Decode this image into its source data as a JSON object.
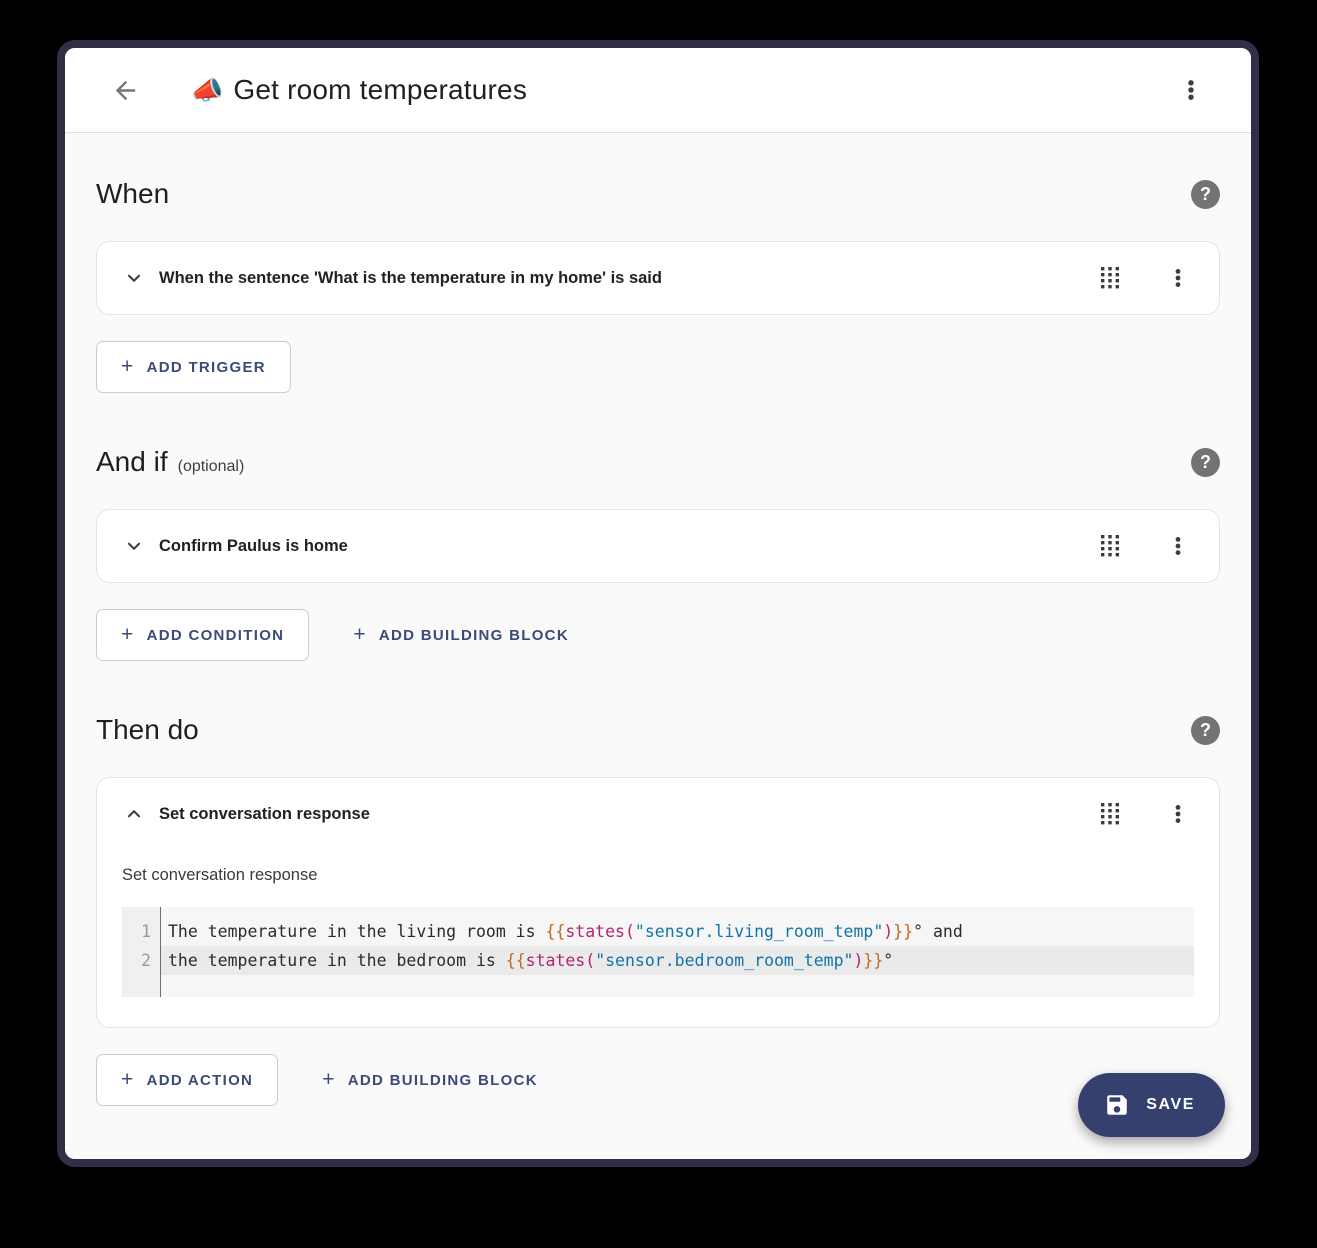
{
  "header": {
    "emoji": "📣",
    "title": "Get room temperatures"
  },
  "icons": {
    "help_glyph": "?",
    "plus_glyph": "+"
  },
  "sections": {
    "when": {
      "heading": "When",
      "card_title": "When the sentence 'What is the temperature in my home' is said",
      "add_trigger_label": "ADD TRIGGER"
    },
    "and_if": {
      "heading": "And if",
      "optional_label": "(optional)",
      "card_title": "Confirm Paulus is home",
      "add_condition_label": "ADD CONDITION",
      "add_building_block_label": "ADD BUILDING BLOCK"
    },
    "then_do": {
      "heading": "Then do",
      "card_title": "Set conversation response",
      "field_label": "Set conversation response",
      "add_action_label": "ADD ACTION",
      "add_building_block_label": "ADD BUILDING BLOCK"
    }
  },
  "editor": {
    "lines": [
      {
        "num": "1",
        "tokens": [
          {
            "t": "The temperature in the living room is "
          },
          {
            "t": "{{"
          },
          {
            "t": "states"
          },
          {
            "t": "("
          },
          {
            "t": "\"sensor.living_room_temp\""
          },
          {
            "t": ")"
          },
          {
            "t": "}}"
          },
          {
            "t": "° and"
          }
        ]
      },
      {
        "num": "2",
        "tokens": [
          {
            "t": "the temperature in the bedroom is "
          },
          {
            "t": "{{"
          },
          {
            "t": "states"
          },
          {
            "t": "("
          },
          {
            "t": "\"sensor.bedroom_room_temp\""
          },
          {
            "t": ")"
          },
          {
            "t": "}}"
          },
          {
            "t": "°"
          }
        ]
      }
    ]
  },
  "save": {
    "label": "SAVE"
  },
  "colors": {
    "frame": "#332d47",
    "accent": "#3b4a78",
    "fab_background": "#35406f",
    "code_tag": "#c2691e",
    "code_function": "#b5246c",
    "code_string": "#1273ab"
  }
}
